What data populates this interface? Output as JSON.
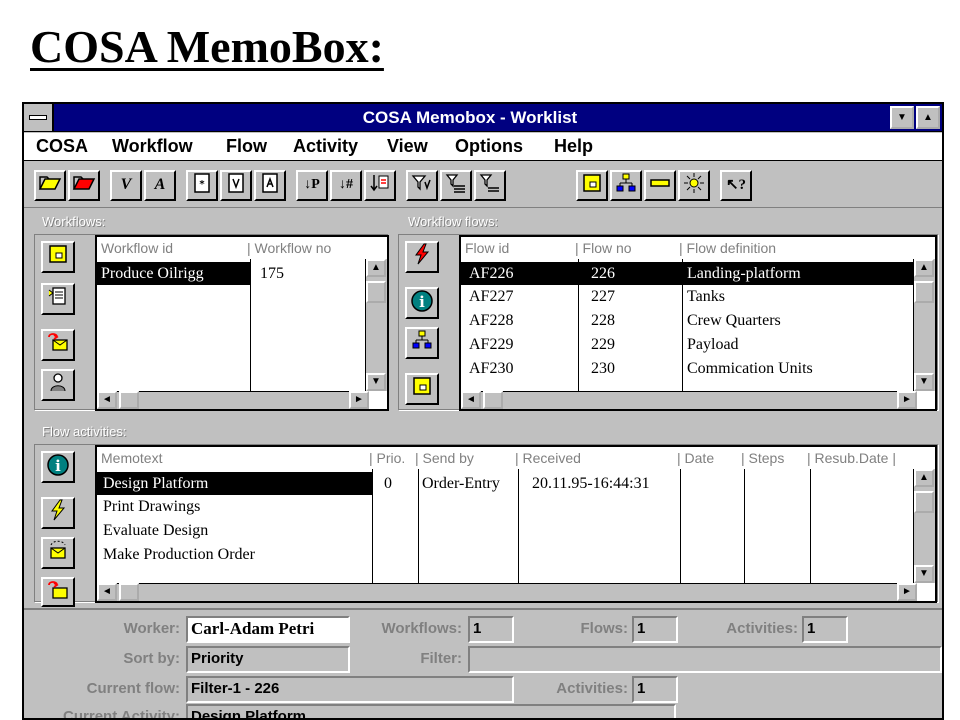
{
  "slide": {
    "title": "COSA MemoBox:"
  },
  "window": {
    "title": "COSA Memobox - Worklist"
  },
  "menus": [
    "COSA",
    "Workflow",
    "Flow",
    "Activity",
    "View",
    "Options",
    "Help"
  ],
  "toolbar": {
    "buttons": [
      {
        "name": "open-folder-icon"
      },
      {
        "name": "open-folder-red-icon"
      },
      {
        "name": "v-icon",
        "glyph": "V"
      },
      {
        "name": "a-icon",
        "glyph": "A"
      },
      {
        "name": "new-document-icon"
      },
      {
        "name": "document-v-icon"
      },
      {
        "name": "document-a-icon"
      },
      {
        "name": "sort-p-icon",
        "glyph": "↓P"
      },
      {
        "name": "sort-number-icon",
        "glyph": "↓#"
      },
      {
        "name": "sort-list-icon"
      },
      {
        "name": "filter-v-icon"
      },
      {
        "name": "filter-list-icon"
      },
      {
        "name": "filter-icon"
      },
      {
        "name": "note-icon"
      },
      {
        "name": "hierarchy-icon"
      },
      {
        "name": "yellow-bar-icon"
      },
      {
        "name": "sun-icon"
      },
      {
        "name": "help-arrow-icon",
        "glyph": "↖?"
      }
    ]
  },
  "workflows": {
    "label": "Workflows:",
    "columns": [
      "Workflow id",
      "Workflow no"
    ],
    "rows": [
      {
        "id": "Produce Oilrigg",
        "no": "175"
      }
    ]
  },
  "workflow_flows": {
    "label": "Workflow flows:",
    "columns": [
      "Flow id",
      "Flow no",
      "Flow definition"
    ],
    "rows": [
      {
        "id": "AF226",
        "no": "226",
        "def": "Landing-platform"
      },
      {
        "id": "AF227",
        "no": "227",
        "def": "Tanks"
      },
      {
        "id": "AF228",
        "no": "228",
        "def": "Crew Quarters"
      },
      {
        "id": "AF229",
        "no": "229",
        "def": "Payload"
      },
      {
        "id": "AF230",
        "no": "230",
        "def": "Commication Units"
      }
    ]
  },
  "flow_activities": {
    "label": "Flow activities:",
    "columns": [
      "Memotext",
      "Prio.",
      "Send by",
      "Received",
      "Date",
      "Steps",
      "Resub.Date"
    ],
    "rows": [
      {
        "memo": "Design Platform",
        "prio": "0",
        "send": "Order-Entry",
        "received": "20.11.95-16:44:31"
      },
      {
        "memo": "Print Drawings",
        "prio": "",
        "send": "",
        "received": ""
      },
      {
        "memo": "Evaluate Design",
        "prio": "",
        "send": "",
        "received": ""
      },
      {
        "memo": "Make Production Order",
        "prio": "",
        "send": "",
        "received": ""
      }
    ]
  },
  "status": {
    "worker_label": "Worker:",
    "worker": "Carl-Adam Petri",
    "workflows_label": "Workflows:",
    "workflows": "1",
    "flows_label": "Flows:",
    "flows": "1",
    "activities_label": "Activities:",
    "activities": "1",
    "sortby_label": "Sort by:",
    "sortby": "Priority",
    "filter_label": "Filter:",
    "filter": "",
    "current_flow_label": "Current flow:",
    "current_flow": "Filter-1 - 226",
    "activities2_label": "Activities:",
    "activities2": "1",
    "current_activity_label": "Current Activity:",
    "current_activity": "Design Platform"
  },
  "colors": {
    "titlebar": "#000080",
    "face": "#c0c0c0",
    "selection": "#000000"
  }
}
